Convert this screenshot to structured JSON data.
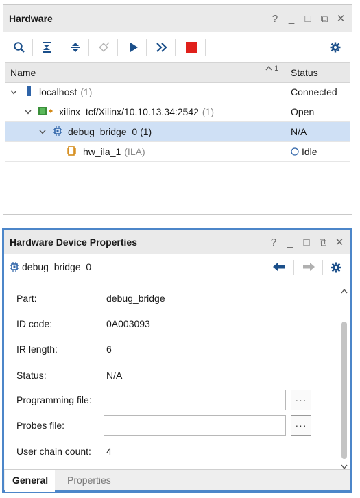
{
  "hardware_panel": {
    "title": "Hardware",
    "window_controls": [
      "?",
      "_",
      "□",
      "⧉",
      "✕"
    ],
    "toolbar": [
      "search-icon",
      "collapse-all-icon",
      "expand-all-icon",
      "auto-connect-icon",
      "run-icon",
      "run-all-icon",
      "stop-icon",
      "settings-icon"
    ],
    "columns": {
      "name": "Name",
      "status": "Status",
      "sort_indicator": "1"
    },
    "rows": [
      {
        "name": "localhost",
        "suffix": "(1)",
        "status": "Connected"
      },
      {
        "name": "xilinx_tcf/Xilinx/10.10.13.34:2542",
        "suffix": "(1)",
        "status": "Open"
      },
      {
        "name": "debug_bridge_0 (1)",
        "suffix": "",
        "status": "N/A"
      },
      {
        "name": "hw_ila_1",
        "suffix": "(ILA)",
        "status": "Idle"
      }
    ]
  },
  "properties_panel": {
    "title": "Hardware Device Properties",
    "device_name": "debug_bridge_0",
    "fields": [
      {
        "label": "Part:",
        "value": "debug_bridge"
      },
      {
        "label": "ID code:",
        "value": "0A003093"
      },
      {
        "label": "IR length:",
        "value": "6"
      },
      {
        "label": "Status:",
        "value": "N/A"
      },
      {
        "label": "Programming file:",
        "value": ""
      },
      {
        "label": "Probes file:",
        "value": ""
      },
      {
        "label": "User chain count:",
        "value": "4"
      }
    ],
    "browse_label": "···",
    "tabs": [
      "General",
      "Properties"
    ]
  },
  "colors": {
    "accent": "#4c86c9",
    "selected_row": "#cfe0f5",
    "stop": "#e0201b",
    "toolbar_icon": "#1b4f8a"
  }
}
